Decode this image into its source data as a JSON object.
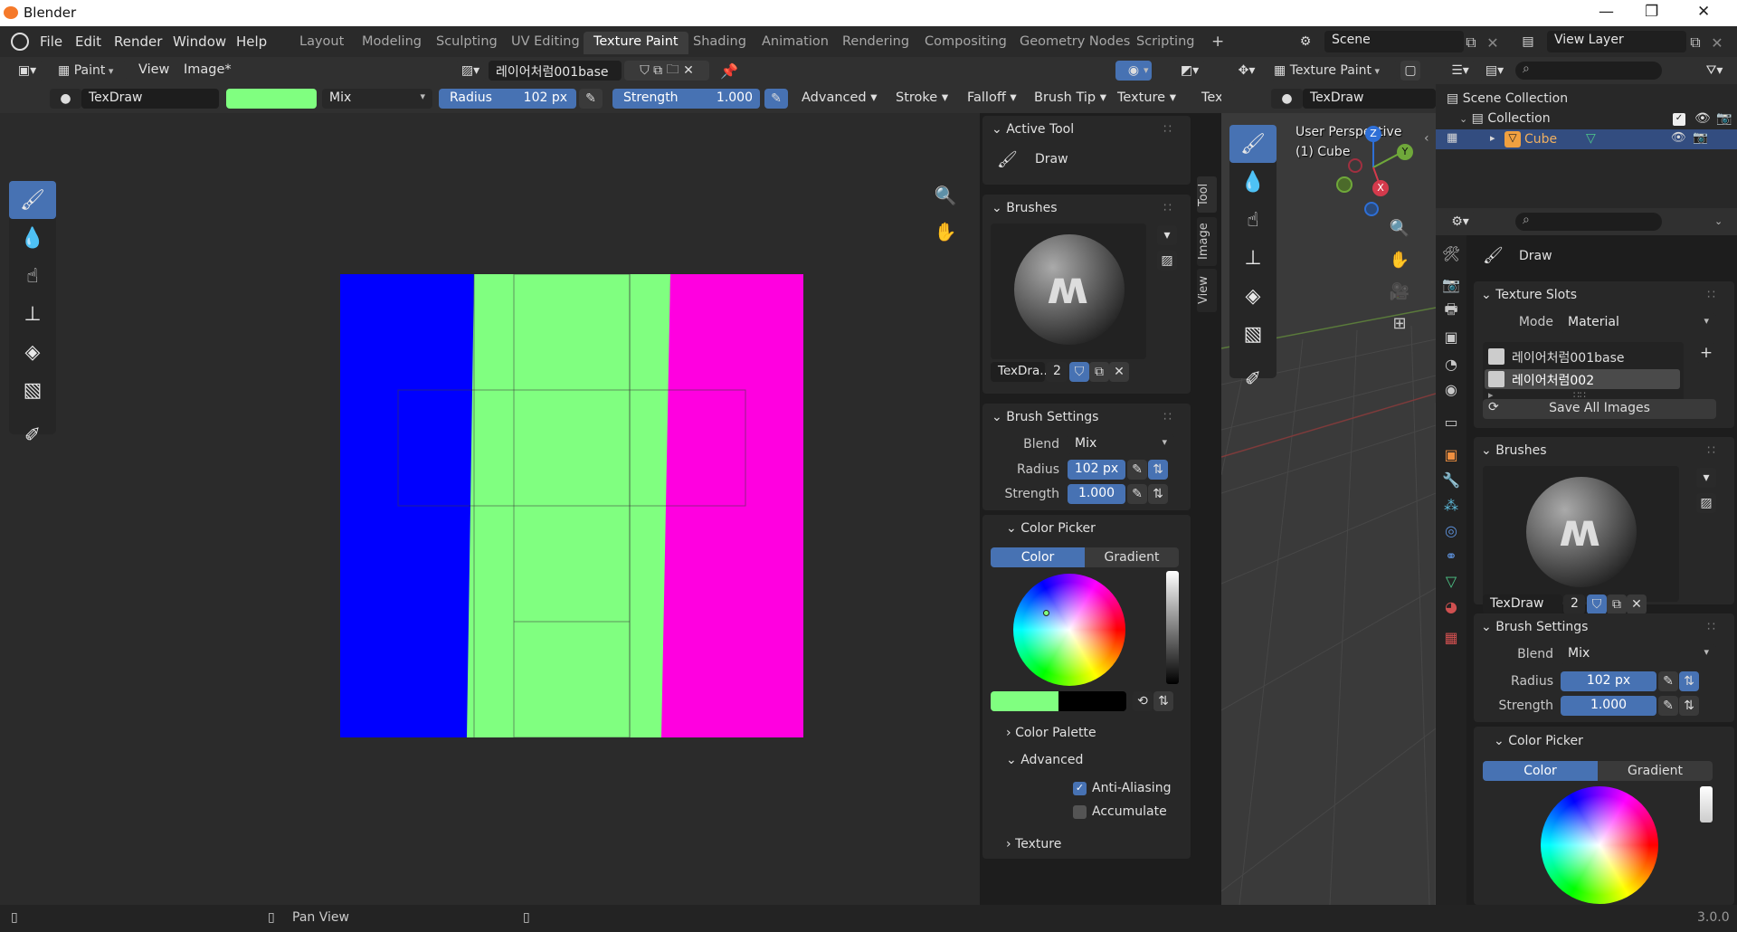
{
  "window": {
    "title": "Blender"
  },
  "menu": {
    "file": "File",
    "edit": "Edit",
    "render": "Render",
    "window": "Window",
    "help": "Help"
  },
  "workspaces": [
    "Layout",
    "Modeling",
    "Sculpting",
    "UV Editing",
    "Texture Paint",
    "Shading",
    "Animation",
    "Rendering",
    "Compositing",
    "Geometry Nodes",
    "Scripting"
  ],
  "workspace_add": "+",
  "scene": {
    "name": "Scene",
    "view_layer": "View Layer"
  },
  "image_editor": {
    "mode": "Paint",
    "view_menu": "View",
    "image_menu": "Image*",
    "image_name": "레이어처럼001base",
    "brush_name": "TexDraw",
    "blend": "Mix",
    "radius_label": "Radius",
    "radius": "102 px",
    "strength_label": "Strength",
    "strength": "1.000",
    "menus": [
      "Advanced",
      "Stroke",
      "Falloff",
      "Brush Tip",
      "Texture",
      "Tex"
    ],
    "canvas_colors": {
      "blue": "#0000ff",
      "green": "#80ff80",
      "magenta": "#ff00e0"
    }
  },
  "sidebar": {
    "tabs": [
      "Tool",
      "Image",
      "View"
    ],
    "active_tool_title": "Active Tool",
    "active_tool_name": "Draw",
    "brushes_title": "Brushes",
    "brush_name_short": "TexDra...",
    "brush_users": "2",
    "brush_settings_title": "Brush Settings",
    "blend_label": "Blend",
    "blend": "Mix",
    "radius_label": "Radius",
    "radius": "102 px",
    "strength_label": "Strength",
    "strength": "1.000",
    "color_picker_title": "Color Picker",
    "color_tab": "Color",
    "gradient_tab": "Gradient",
    "color_palette": "Color Palette",
    "advanced": "Advanced",
    "anti_aliasing": "Anti-Aliasing",
    "accumulate": "Accumulate",
    "texture": "Texture",
    "primary_color": "#80ff80",
    "secondary_color": "#000000"
  },
  "viewport": {
    "mode": "Texture Paint",
    "brush_name": "TexDraw",
    "perspective": "User Perspective",
    "object_label": "(1) Cube",
    "gizmo_z": "Z",
    "gizmo_y": "Y",
    "gizmo_x": "X"
  },
  "outliner": {
    "scene_collection": "Scene Collection",
    "collection": "Collection",
    "cube": "Cube"
  },
  "properties": {
    "tool_name": "Draw",
    "texture_slots_title": "Texture Slots",
    "mode_label": "Mode",
    "mode": "Material",
    "slots": [
      "레이어처럼001base",
      "레이어처럼002"
    ],
    "save_all": "Save All Images",
    "brushes_title": "Brushes",
    "brush_name": "TexDraw",
    "brush_users": "2",
    "brush_settings_title": "Brush Settings",
    "blend_label": "Blend",
    "blend": "Mix",
    "radius_label": "Radius",
    "radius": "102 px",
    "strength_label": "Strength",
    "strength": "1.000",
    "color_picker_title": "Color Picker",
    "color_tab": "Color",
    "gradient_tab": "Gradient"
  },
  "statusbar": {
    "pan_view": "Pan View",
    "version": "3.0.0"
  }
}
